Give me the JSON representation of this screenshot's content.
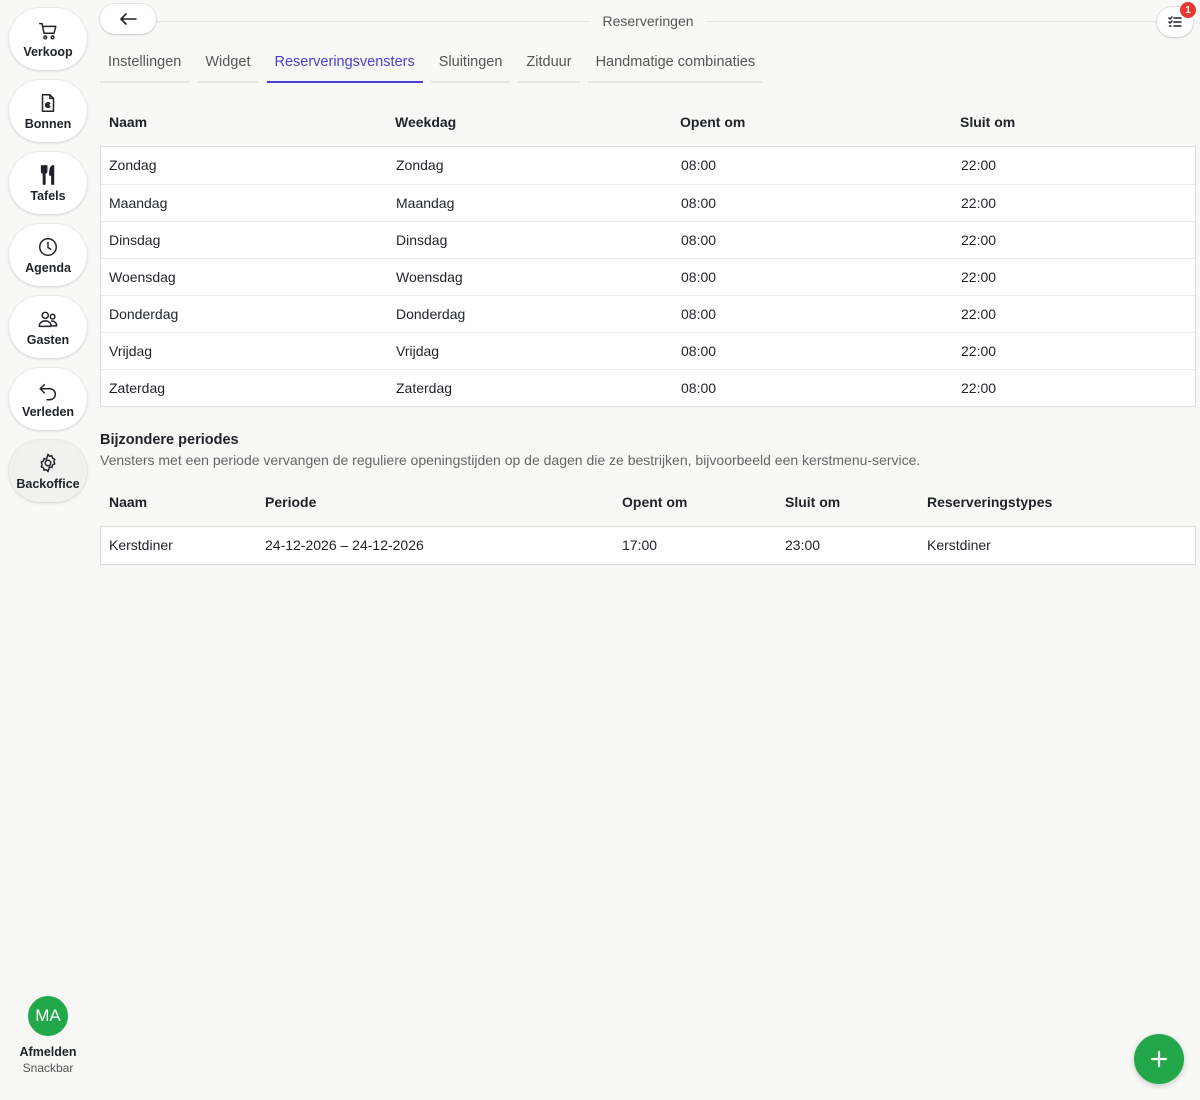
{
  "sidebar": {
    "items": [
      {
        "label": "Verkoop",
        "icon": "cart-icon"
      },
      {
        "label": "Bonnen",
        "icon": "receipt-euro-icon"
      },
      {
        "label": "Tafels",
        "icon": "fork-knife-icon"
      },
      {
        "label": "Agenda",
        "icon": "clock-icon"
      },
      {
        "label": "Gasten",
        "icon": "users-icon"
      },
      {
        "label": "Verleden",
        "icon": "undo-arrow-icon"
      },
      {
        "label": "Backoffice",
        "icon": "gear-icon"
      }
    ],
    "active_item": "Backoffice",
    "user": {
      "initials": "MA",
      "action": "Afmelden",
      "location": "Snackbar",
      "avatar_color": "#22a84a"
    }
  },
  "header": {
    "title": "Reserveringen",
    "tasks_badge": "1"
  },
  "tabs": [
    {
      "label": "Instellingen"
    },
    {
      "label": "Widget"
    },
    {
      "label": "Reserveringsvensters"
    },
    {
      "label": "Sluitingen"
    },
    {
      "label": "Zitduur"
    },
    {
      "label": "Handmatige combinaties"
    }
  ],
  "active_tab": "Reserveringsvensters",
  "windows_table": {
    "columns": [
      "Naam",
      "Weekdag",
      "Opent om",
      "Sluit om"
    ],
    "rows": [
      [
        "Zondag",
        "Zondag",
        "08:00",
        "22:00"
      ],
      [
        "Maandag",
        "Maandag",
        "08:00",
        "22:00"
      ],
      [
        "Dinsdag",
        "Dinsdag",
        "08:00",
        "22:00"
      ],
      [
        "Woensdag",
        "Woensdag",
        "08:00",
        "22:00"
      ],
      [
        "Donderdag",
        "Donderdag",
        "08:00",
        "22:00"
      ],
      [
        "Vrijdag",
        "Vrijdag",
        "08:00",
        "22:00"
      ],
      [
        "Zaterdag",
        "Zaterdag",
        "08:00",
        "22:00"
      ]
    ]
  },
  "special_periods": {
    "title": "Bijzondere periodes",
    "description": "Vensters met een periode vervangen de reguliere openingstijden op de dagen die ze bestrijken, bijvoorbeeld een kerstmenu-service.",
    "columns": [
      "Naam",
      "Periode",
      "Opent om",
      "Sluit om",
      "Reserveringstypes"
    ],
    "rows": [
      [
        "Kerstdiner",
        "24-12-2026 – 24-12-2026",
        "17:00",
        "23:00",
        "Kerstdiner"
      ]
    ]
  },
  "colors": {
    "accent": "#4a3fd1",
    "primary_green": "#22a84a",
    "badge_red": "#e53935"
  }
}
